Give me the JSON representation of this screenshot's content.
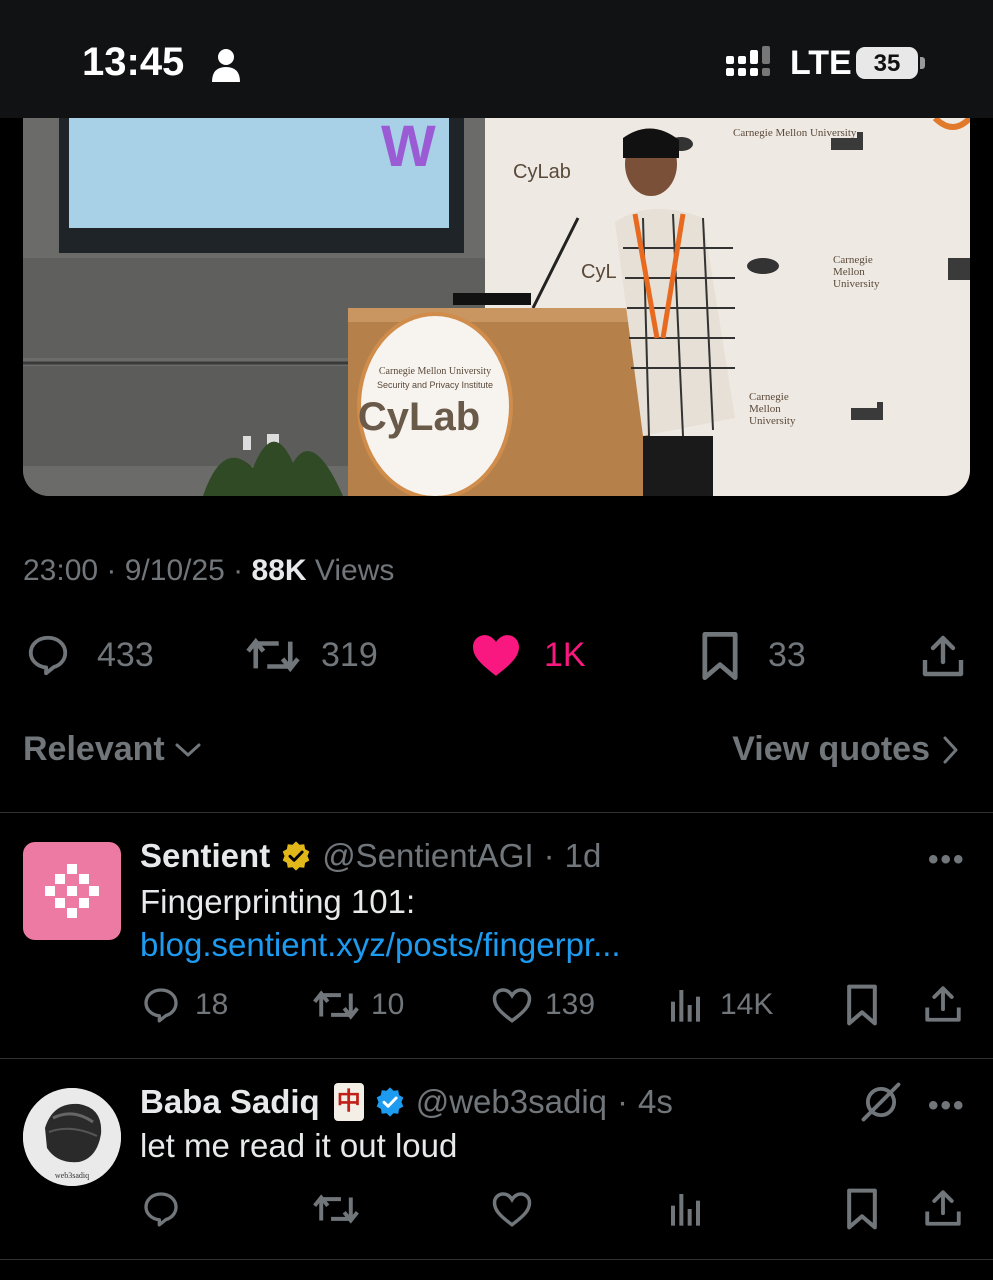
{
  "status_bar": {
    "time": "13:45",
    "network": "LTE",
    "battery": "35"
  },
  "tweet": {
    "time": "23:00",
    "date": "9/10/25",
    "views_count": "88K",
    "views_label": "Views",
    "replies": "433",
    "reposts": "319",
    "likes": "1K",
    "bookmarks": "33",
    "photo_signage": {
      "podium_line1": "Carnegie Mellon University",
      "podium_line2": "Security and Privacy Institute",
      "podium_brand": "CyLab",
      "backdrop_brand": "CyLab",
      "backdrop_cmu": "Carnegie Mellon University"
    }
  },
  "replies_header": {
    "sort_label": "Relevant",
    "quotes_label": "View quotes"
  },
  "replies": [
    {
      "name": "Sentient",
      "handle": "@SentientAGI",
      "age": "1d",
      "text": "Fingerprinting 101:",
      "link": "blog.sentient.xyz/posts/fingerpr...",
      "replies": "18",
      "reposts": "10",
      "likes": "139",
      "views": "14K"
    },
    {
      "name": "Baba Sadiq",
      "flag": "🀄",
      "handle": "@web3sadiq",
      "age": "4s",
      "text": "let me read it out loud",
      "avatar_caption": "web3sadiq"
    }
  ],
  "colors": {
    "background": "#000000",
    "secondary_text": "#71767b",
    "like_pink": "#f91880",
    "link_blue": "#1d9bf0",
    "verified_gold": "#e2b719",
    "verified_blue": "#1d9bf0"
  }
}
